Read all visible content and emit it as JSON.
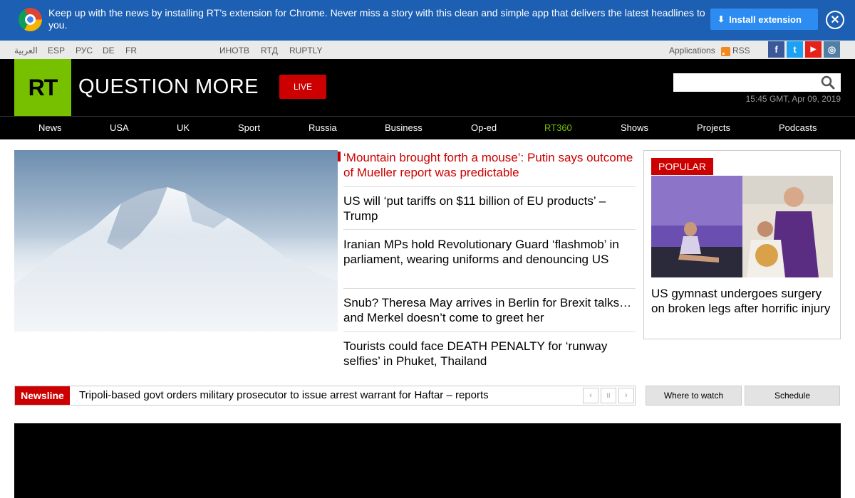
{
  "banner": {
    "text": "Keep up with the news by installing RT’s extension for Chrome. Never miss a story with this clean and simple app that delivers the latest headlines to you.",
    "install_label": "Install extension",
    "close_glyph": "✕",
    "icons": [
      "chrome-logo-icon",
      "download-icon",
      "close-icon"
    ]
  },
  "topbar": {
    "languages": [
      "العربية",
      "ESP",
      "РУС",
      "DE",
      "FR"
    ],
    "partners": [
      "ИНОТВ",
      "RTД",
      "RUPTLY"
    ],
    "applications": "Applications",
    "rss": "RSS",
    "social": [
      {
        "name": "facebook-icon",
        "glyph": "f",
        "color": "#3b5998"
      },
      {
        "name": "twitter-icon",
        "glyph": "t",
        "color": "#1da1f2"
      },
      {
        "name": "youtube-icon",
        "glyph": "▶",
        "color": "#e62117"
      },
      {
        "name": "instagram-icon",
        "glyph": "◎",
        "color": "#517fa4"
      }
    ]
  },
  "header": {
    "logo": "RT",
    "slogan": "QUESTION MORE",
    "live": "LIVE",
    "search_value": "",
    "datetime": "15:45 GMT, Apr 09, 2019"
  },
  "nav": {
    "items": [
      "News",
      "USA",
      "UK",
      "Sport",
      "Russia",
      "Business",
      "Op-ed",
      "RT360",
      "Shows",
      "Projects",
      "Podcasts"
    ],
    "highlight": "RT360",
    "highlight_color": "#77c000"
  },
  "headlines": [
    "‘Mountain brought forth a mouse’: Putin says outcome of Mueller report was predictable",
    "US will ‘put tariffs on $11 billion of EU products’ – Trump",
    "Iranian MPs hold Revolutionary Guard ‘flashmob’ in parliament, wearing uniforms and denouncing US",
    "Snub? Theresa May arrives in Berlin for Brexit talks… and Merkel doesn’t come to greet her",
    "Tourists could face DEATH PENALTY for ‘runway selfies’ in Phuket, Thailand"
  ],
  "popular": {
    "label": "POPULAR",
    "title": "US gymnast undergoes surgery on broken legs after horrific injury"
  },
  "newsline": {
    "label": "Newsline",
    "text": "Tripoli-based govt orders military prosecutor to issue arrest warrant for Haftar – reports",
    "prev": "‹",
    "pause": "II",
    "next": "›"
  },
  "buttons": {
    "where_to_watch": "Where to watch",
    "schedule": "Schedule"
  },
  "colors": {
    "accent_red": "#cc0000",
    "brand_green": "#77c000",
    "banner_blue": "#1c5fb3"
  }
}
